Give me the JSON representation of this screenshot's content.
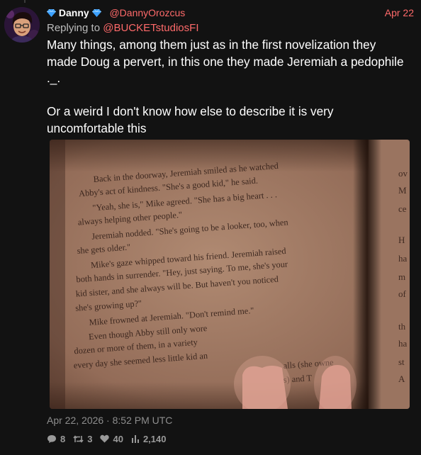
{
  "tweet": {
    "author": {
      "name": "Danny",
      "handle": "@DannyOrozcus",
      "badge_icon": "diamond-icon"
    },
    "date": "Apr 22",
    "reply_prefix": "Replying to",
    "reply_handle": "@BUCKETstudiosFI",
    "text_lines": [
      "Many things, among them just as in the first novelization they made Doug a pervert, in this one they made Jeremiah a pedophile ._.",
      "Or a weird I don't know how else to describe it is very uncomfortable this"
    ],
    "timestamp": "Apr 22, 2026 · 8:52 PM UTC",
    "stats": {
      "comments": "8",
      "retweets": "3",
      "likes": "40",
      "views": "2,140"
    }
  },
  "book_page": {
    "lines": [
      "Back in the doorway, Jeremiah smiled as he watched",
      "Abby's act of kindness. \"She's a good kid,\" he said.",
      "\"Yeah, she is,\" Mike agreed. \"She has a big heart . . .",
      "always helping other people.\"",
      "Jeremiah nodded. \"She's going to be a looker, too, when",
      "she gets older.\"",
      "Mike's gaze whipped toward his friend. Jeremiah raised",
      "both hands in surrender. \"Hey, just saying. To me, she's your",
      "kid sister, and she always will be. But haven't you noticed",
      "she's growing up?\"",
      "Mike frowned at Jeremiah. \"Don't remind me.\"",
      "Even though Abby still only wore",
      "dozen or more of them, in a variety",
      "every day she seemed less little kid an"
    ],
    "lines_tail": [
      "alls (she owne",
      "s) and T"
    ],
    "right_page_fragments": [
      "ov",
      "M",
      "ce",
      "H",
      "ha",
      "m",
      "of",
      "th",
      "ha",
      "st",
      "A"
    ],
    "colors": {
      "page": "#a07a64",
      "ink": "#2a1812",
      "gutter": "#3a2218",
      "finger": "#d89a8e"
    }
  },
  "colors": {
    "accent": "#ff6a6a",
    "badge": "#3aa0ff",
    "background": "#121212"
  }
}
